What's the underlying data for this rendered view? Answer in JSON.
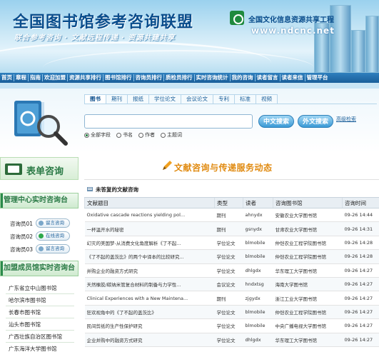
{
  "header": {
    "title": "全国图书馆参考咨询联盟",
    "slogan": "联合参考咨询 · 文献远程传递 · 资源共建共享",
    "project_name": "全国文化信息资源共享工程",
    "project_url": "www.ndcnc.net"
  },
  "nav": [
    "首页",
    "章程",
    "指南",
    "欢迎加盟",
    "资源共享排行",
    "图书馆排行",
    "咨询员排行",
    "质检员排行",
    "实时咨询统计",
    "我的咨询",
    "读者留言",
    "读者来信",
    "管理平台"
  ],
  "search": {
    "tabs": [
      "图书",
      "期刊",
      "报纸",
      "学位论文",
      "会议论文",
      "专利",
      "标准",
      "视频"
    ],
    "active_tab": 0,
    "input_value": "",
    "chinese_button": "中文搜索",
    "foreign_button": "外文搜索",
    "advanced_link": "高级检索",
    "radios": [
      {
        "label": "全部字段",
        "checked": true
      },
      {
        "label": "书名",
        "checked": false
      },
      {
        "label": "作者",
        "checked": false
      },
      {
        "label": "主题词",
        "checked": false
      }
    ]
  },
  "sidebar": {
    "table_consult": "表单咨询",
    "realtime_header": "管理中心实时咨询台",
    "staff": [
      {
        "name": "咨询员01",
        "button": "留言咨询",
        "online": false
      },
      {
        "name": "咨询员02",
        "button": "在线咨询",
        "online": true
      },
      {
        "name": "咨询员03",
        "button": "留言咨询",
        "online": false
      }
    ],
    "member_header": "加盟成员馆实时咨询台",
    "libraries": [
      "广东省立中山图书馆",
      "哈尔滨市图书馆",
      "长春市图书馆",
      "汕头市图书馆",
      "广西壮族自治区图书馆",
      "广东海洋大学图书馆"
    ]
  },
  "main": {
    "section_title": "文献咨询与传递服务动态",
    "unanswered_label": "未答复的文献咨询",
    "columns": [
      "文献题目",
      "类型",
      "读者",
      "咨询图书馆",
      "咨询时间"
    ],
    "rows": [
      [
        "Oxidative cascade reactions yielding pol...",
        "期刊",
        "ahnydx",
        "安徽农业大学图书馆",
        "09-26 14:44"
      ],
      [
        "一杯温开水的秘密",
        "期刊",
        "gsnydx",
        "甘肃农业大学图书馆",
        "09-26 14:31"
      ],
      [
        "幻灭的美国梦-从消费文化角度解析《了不起...",
        "学位论文",
        "blmobile",
        "仲恺农业工程学院图书馆",
        "09-26 14:28"
      ],
      [
        "《了不起的盖茨比》的两个中译本的比较研究...",
        "学位论文",
        "blmobile",
        "仲恺农业工程学院图书馆",
        "09-26 14:28"
      ],
      [
        "并购企业的融资方式研究",
        "学位论文",
        "dhlgdx",
        "华东理工大学图书馆",
        "09-26 14:27"
      ],
      [
        "天然橡胶/碳纳米管复合材料的制备与力学性...",
        "会议论文",
        "hndxtsg",
        "海南大学图书馆",
        "09-26 14:27"
      ],
      [
        "Clinical Experiences with a New Maintena...",
        "期刊",
        "zjgydx",
        "浙江工业大学图书馆",
        "09-26 14:27"
      ],
      [
        "狂欢视角中的《了不起的盖茨比》",
        "学位论文",
        "blmobile",
        "仲恺农业工程学院图书馆",
        "09-26 14:27"
      ],
      [
        "民间剪纸的生产性保护研究",
        "学位论文",
        "blmobile",
        "中央广播电视大学图书馆",
        "09-26 14:27"
      ],
      [
        "企业并购中的融资方式研究",
        "学位论文",
        "dhlgdx",
        "华东理工大学图书馆",
        "09-26 14:27"
      ]
    ]
  }
}
